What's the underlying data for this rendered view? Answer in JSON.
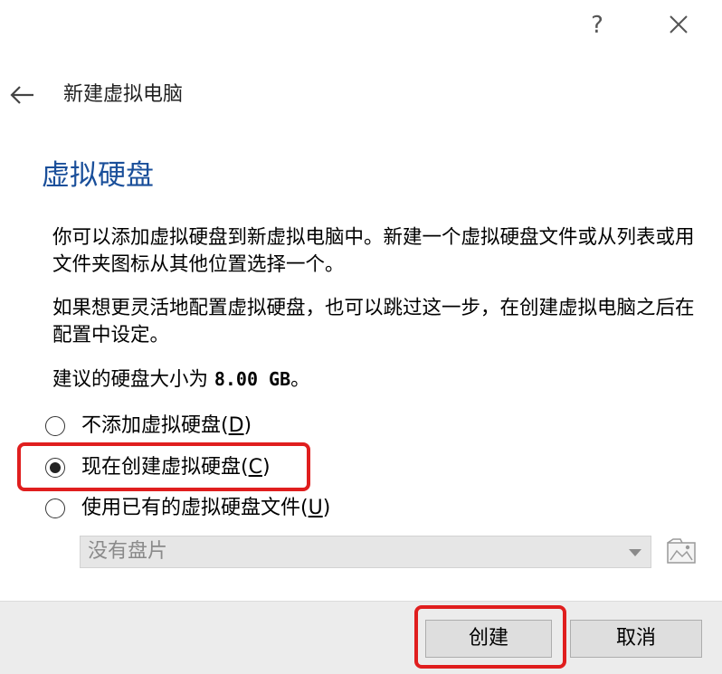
{
  "titlebar": {
    "help_label": "?",
    "close_icon": "close-icon"
  },
  "header": {
    "back_icon": "arrow-left-icon",
    "title": "新建虚拟电脑"
  },
  "page": {
    "heading": "虚拟硬盘",
    "paragraph_1": "你可以添加虚拟硬盘到新虚拟电脑中。新建一个虚拟硬盘文件或从列表或用文件夹图标从其他位置选择一个。",
    "paragraph_2": "如果想更灵活地配置虚拟硬盘，也可以跳过这一步，在创建虚拟电脑之后在配置中设定。",
    "suggest_prefix": "建议的硬盘大小为 ",
    "suggest_size": "8.00 GB",
    "suggest_suffix": "。"
  },
  "options": [
    {
      "label": "不添加虚拟硬盘(",
      "key": "D",
      "close": ")",
      "selected": false
    },
    {
      "label": "现在创建虚拟硬盘(",
      "key": "C",
      "close": ")",
      "selected": true
    },
    {
      "label": "使用已有的虚拟硬盘文件(",
      "key": "U",
      "close": ")",
      "selected": false
    }
  ],
  "disk_select": {
    "value": "没有盘片",
    "enabled": false,
    "folder_icon": "folder-image-icon"
  },
  "footer": {
    "create_label": "创建",
    "cancel_label": "取消"
  },
  "colors": {
    "heading": "#1a4f9a",
    "highlight": "#e01e1e",
    "footer_bg": "#ececec",
    "button_bg": "#dedede"
  }
}
